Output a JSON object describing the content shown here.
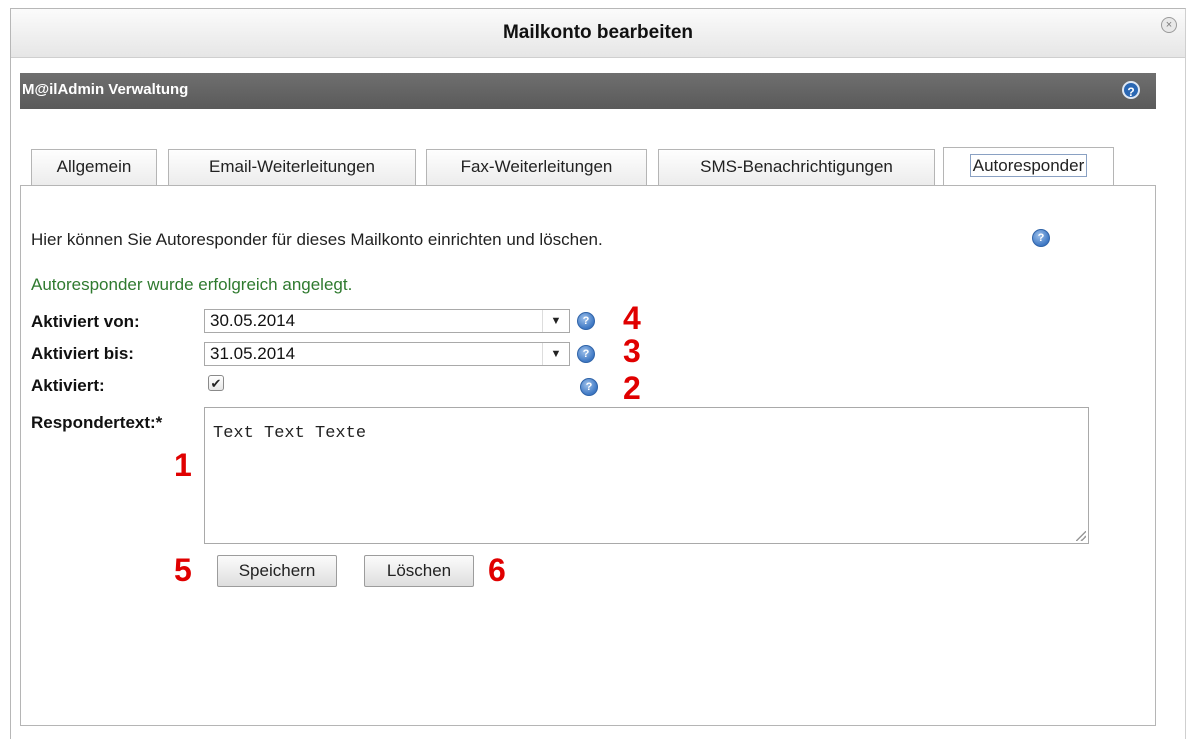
{
  "dialog": {
    "title": "Mailkonto bearbeiten",
    "close_icon": "close-icon"
  },
  "admin_bar": {
    "title": "M@ilAdmin Verwaltung",
    "help_icon": "help-icon"
  },
  "tabs": [
    {
      "label": "Allgemein"
    },
    {
      "label": "Email-Weiterleitungen"
    },
    {
      "label": "Fax-Weiterleitungen"
    },
    {
      "label": "SMS-Benachrichtigungen"
    },
    {
      "label": "Autoresponder",
      "active": true
    }
  ],
  "intro_text": "Hier können Sie Autoresponder für dieses Mailkonto einrichten und löschen.",
  "success_message": "Autoresponder wurde erfolgreich angelegt.",
  "form": {
    "from_label": "Aktiviert von:",
    "from_value": "30.05.2014",
    "to_label": "Aktiviert bis:",
    "to_value": "31.05.2014",
    "active_label": "Aktiviert:",
    "active_checked": true,
    "text_label": "Respondertext:*",
    "text_value": "Text Text Texte"
  },
  "buttons": {
    "save": "Speichern",
    "delete": "Löschen"
  },
  "markers": {
    "m1": "1",
    "m2": "2",
    "m3": "3",
    "m4": "4",
    "m5": "5",
    "m6": "6"
  },
  "colors": {
    "success": "#2f7a2f",
    "marker": "#e00000",
    "admin_bar": "#606060",
    "help_blue": "#3e78c4"
  }
}
